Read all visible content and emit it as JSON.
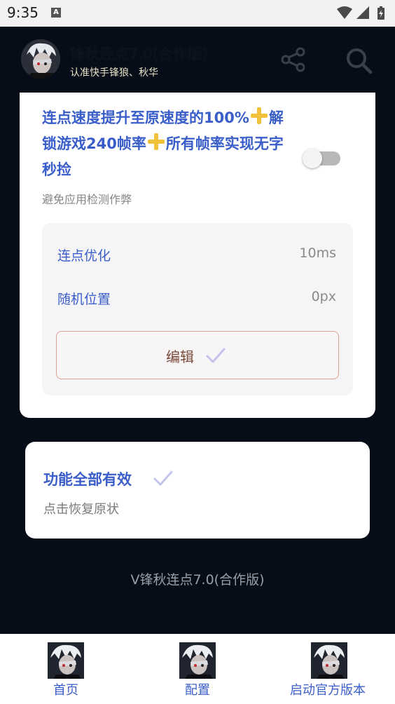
{
  "status_bar": {
    "time": "9:35",
    "notification_letter": "A"
  },
  "header": {
    "title": "锋秋连点7.0(合作版)",
    "subtitle": "认准快手锋狼、秋华",
    "share_icon": "share-icon",
    "search_icon": "search-icon"
  },
  "card1": {
    "title_part1": "连点速度提升至原速度的100%",
    "title_part2": "解锁游戏240帧率",
    "title_part3": "所有帧率实现无字秒捡",
    "plus_icon": "yellow-plus-icon",
    "toggle_state": "off",
    "subtitle": "避免应用检测作弊",
    "rows": [
      {
        "label": "连点优化",
        "value": "10ms"
      },
      {
        "label": "随机位置",
        "value": "0px"
      }
    ],
    "edit_label": "编辑"
  },
  "card2": {
    "title": "功能全部有效",
    "subtitle": "点击恢复原状"
  },
  "version_text": "V锋秋连点7.0(合作版)",
  "bottom_nav": [
    {
      "label": "首页"
    },
    {
      "label": "配置"
    },
    {
      "label": "启动官方版本"
    }
  ],
  "colors": {
    "background": "#070d18",
    "accent_blue": "#3a5ec9",
    "plus_yellow": "#f0c23a",
    "edit_border": "#d8a391"
  }
}
